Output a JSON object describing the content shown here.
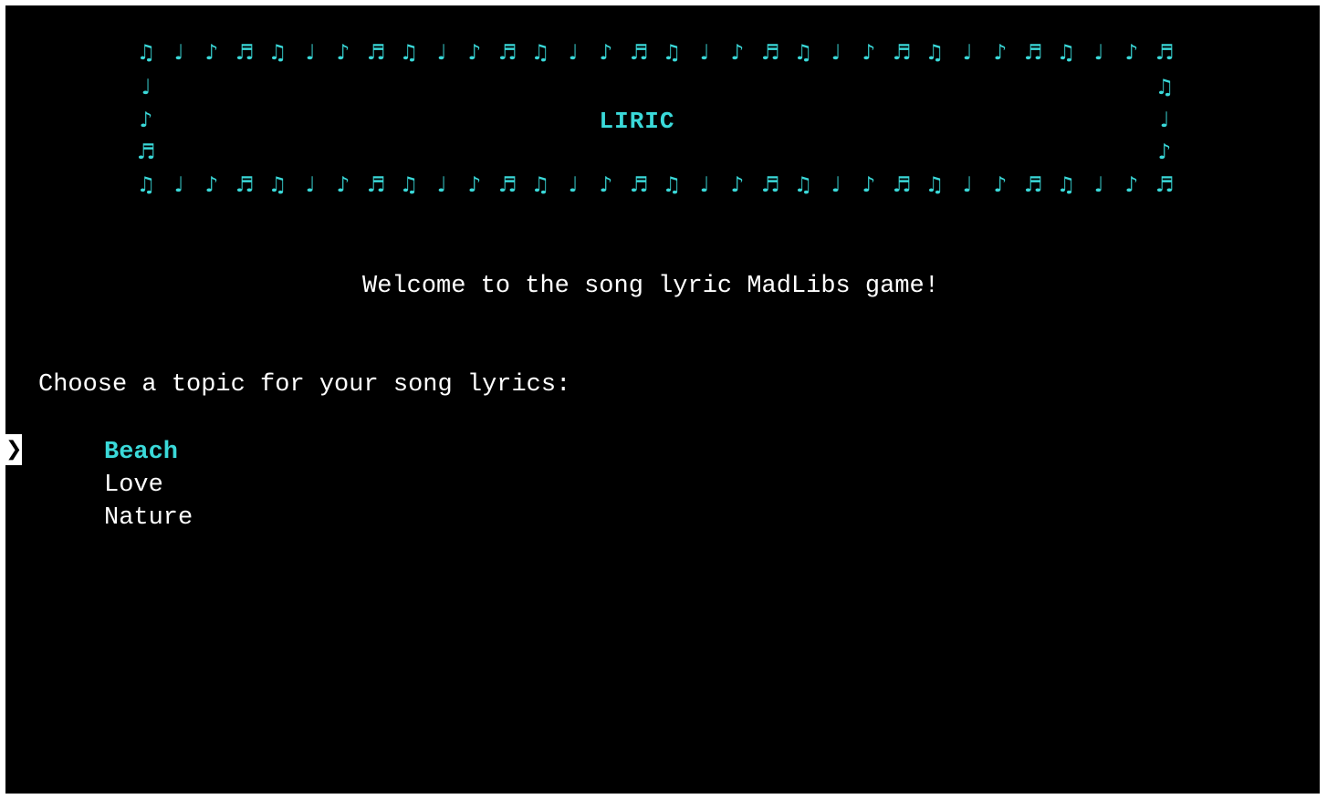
{
  "colors": {
    "background": "#000000",
    "accent": "#3ad9d9",
    "text": "#ffffff"
  },
  "banner": {
    "top_row": [
      "♫",
      "♩",
      "♪",
      "♬",
      "♫",
      "♩",
      "♪",
      "♬",
      "♫",
      "♩",
      "♪",
      "♬",
      "♫",
      "♩",
      "♪",
      "♬",
      "♫",
      "♩",
      "♪",
      "♬",
      "♫",
      "♩",
      "♪",
      "♬",
      "♫",
      "♩",
      "♪",
      "♬",
      "♫",
      "♩",
      "♪",
      "♬"
    ],
    "bottom_row": [
      "♫",
      "♩",
      "♪",
      "♬",
      "♫",
      "♩",
      "♪",
      "♬",
      "♫",
      "♩",
      "♪",
      "♬",
      "♫",
      "♩",
      "♪",
      "♬",
      "♫",
      "♩",
      "♪",
      "♬",
      "♫",
      "♩",
      "♪",
      "♬",
      "♫",
      "♩",
      "♪",
      "♬",
      "♫",
      "♩",
      "♪",
      "♬"
    ],
    "left_column": [
      "♩",
      "♪",
      "♬"
    ],
    "right_column": [
      "♫",
      "♩",
      "♪"
    ],
    "title": "LIRIC"
  },
  "welcome_text": "Welcome to the song lyric MadLibs game!",
  "prompt_text": "Choose a topic for your song lyrics:",
  "cursor_glyph": "❯",
  "options": [
    {
      "label": "Beach",
      "selected": true
    },
    {
      "label": "Love",
      "selected": false
    },
    {
      "label": "Nature",
      "selected": false
    }
  ]
}
